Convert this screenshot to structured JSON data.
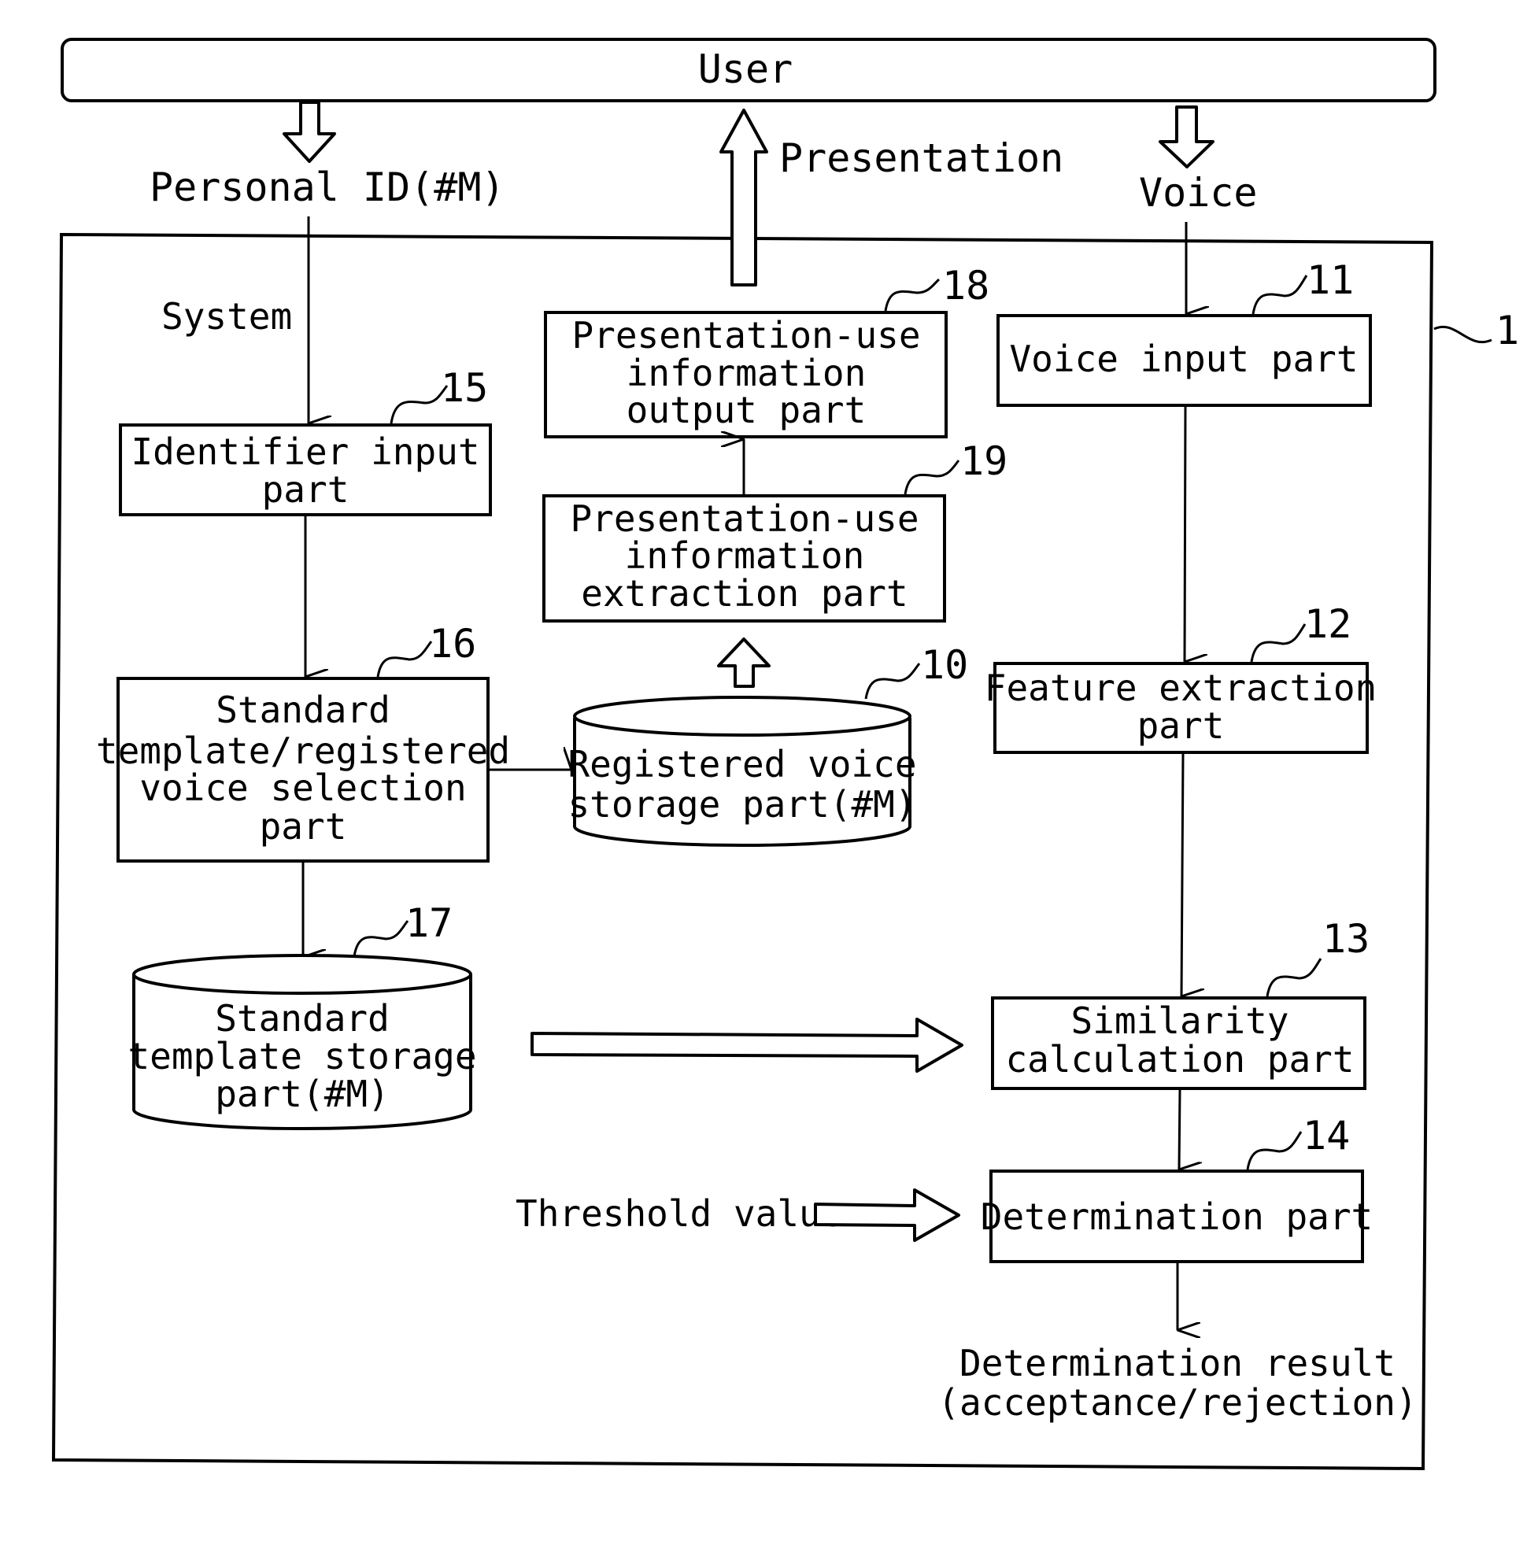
{
  "figure": {
    "actor": "User",
    "system_label": "System",
    "system_ref": "1",
    "flows": {
      "personal_id": "Personal ID(#M)",
      "presentation": "Presentation",
      "voice": "Voice",
      "threshold": "Threshold value"
    },
    "blocks": [
      {
        "id": "identifier",
        "ref": "15",
        "shape": "box",
        "lines": [
          "Identifier input",
          "part"
        ]
      },
      {
        "id": "selection",
        "ref": "16",
        "shape": "box",
        "lines": [
          "Standard",
          "template/registered",
          "voice selection",
          "part"
        ]
      },
      {
        "id": "std_storage",
        "ref": "17",
        "shape": "cylinder",
        "lines": [
          "Standard",
          "template storage",
          "part(#M)"
        ]
      },
      {
        "id": "pres_output",
        "ref": "18",
        "shape": "box",
        "lines": [
          "Presentation-use",
          "information",
          "output part"
        ]
      },
      {
        "id": "pres_extract",
        "ref": "19",
        "shape": "box",
        "lines": [
          "Presentation-use",
          "information",
          "extraction part"
        ]
      },
      {
        "id": "reg_storage",
        "ref": "10",
        "shape": "cylinder",
        "lines": [
          "Registered voice",
          "storage part(#M)"
        ]
      },
      {
        "id": "voice_input",
        "ref": "11",
        "shape": "box",
        "lines": [
          "Voice input part"
        ]
      },
      {
        "id": "feature",
        "ref": "12",
        "shape": "box",
        "lines": [
          "Feature extraction",
          "part"
        ]
      },
      {
        "id": "similarity",
        "ref": "13",
        "shape": "box",
        "lines": [
          "Similarity",
          "calculation part"
        ]
      },
      {
        "id": "determination",
        "ref": "14",
        "shape": "box",
        "lines": [
          "Determination part"
        ]
      }
    ],
    "output": {
      "lines": [
        "Determination result",
        "(acceptance/rejection)"
      ]
    }
  }
}
